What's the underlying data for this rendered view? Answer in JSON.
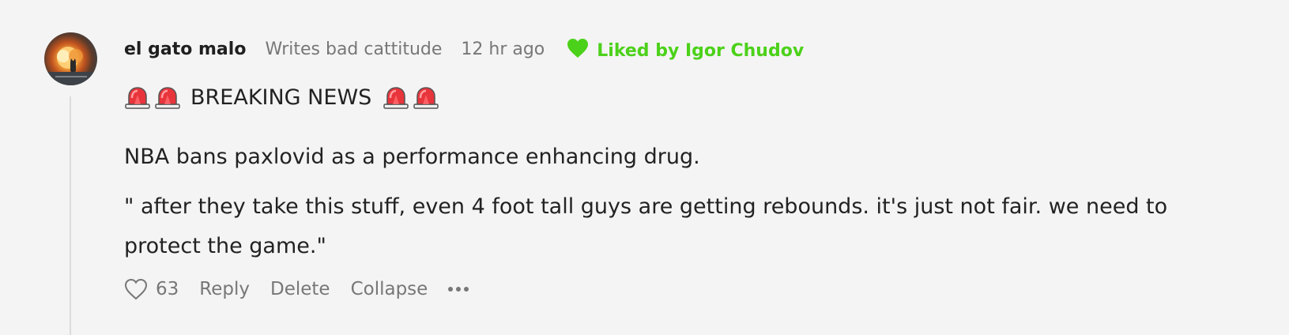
{
  "comment": {
    "author": "el gato malo",
    "tagline": "Writes bad cattitude",
    "timestamp": "12 hr ago",
    "liked_by": "Liked by Igor Chudov",
    "breaking": "BREAKING NEWS",
    "paragraphs": [
      "NBA bans paxlovid as a performance enhancing drug.",
      "\" after they take this stuff, even 4 foot tall guys are getting rebounds. it's just not fair. we need to protect the game.\""
    ],
    "actions": {
      "like_count": "63",
      "reply": "Reply",
      "delete": "Delete",
      "collapse": "Collapse"
    }
  },
  "colors": {
    "liked_green": "#4cd11a",
    "muted_text": "#777777",
    "background": "#f4f4f4"
  },
  "icons": {
    "liked": "heart-filled-icon",
    "siren": "siren-emoji-icon",
    "like_action": "heart-outline-icon",
    "more": "ellipsis-icon"
  }
}
